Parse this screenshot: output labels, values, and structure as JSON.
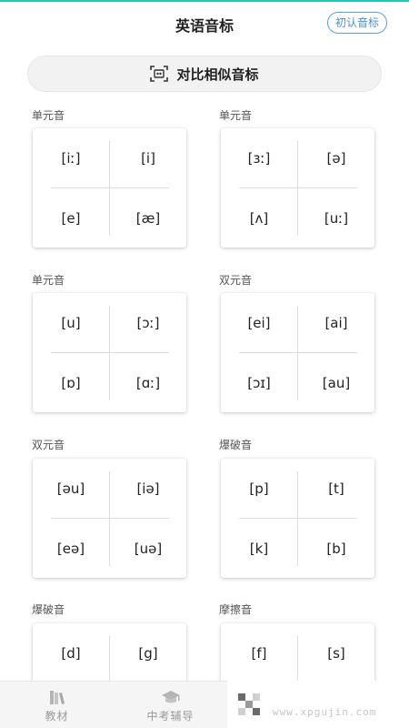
{
  "header": {
    "title": "英语音标",
    "intro_button": "初认音标"
  },
  "compare": {
    "label": "对比相似音标",
    "icon": "compare-scan-icon"
  },
  "groups": [
    {
      "label": "单元音",
      "symbols": [
        "[iː]",
        "[i]",
        "[e]",
        "[æ]"
      ]
    },
    {
      "label": "单元音",
      "symbols": [
        "[ɜː]",
        "[ə]",
        "[ʌ]",
        "[uː]"
      ]
    },
    {
      "label": "单元音",
      "symbols": [
        "[u]",
        "[ɔː]",
        "[ɒ]",
        "[ɑː]"
      ]
    },
    {
      "label": "双元音",
      "symbols": [
        "[ei]",
        "[ai]",
        "[ɔɪ]",
        "[au]"
      ]
    },
    {
      "label": "双元音",
      "symbols": [
        "[əu]",
        "[iə]",
        "[eə]",
        "[uə]"
      ]
    },
    {
      "label": "爆破音",
      "symbols": [
        "[p]",
        "[t]",
        "[k]",
        "[b]"
      ]
    },
    {
      "label": "爆破音",
      "symbols": [
        "[d]",
        "[g]",
        "",
        ""
      ]
    },
    {
      "label": "摩擦音",
      "symbols": [
        "[f]",
        "[s]",
        "",
        ""
      ]
    }
  ],
  "bottom_nav": [
    {
      "label": "教材",
      "icon": "books-icon"
    },
    {
      "label": "中考辅导",
      "icon": "graduation-cap-icon"
    }
  ],
  "watermark": "www.xpgujin.com",
  "colors": {
    "accent": "#2bc3b3",
    "link": "#4a8fe0"
  }
}
